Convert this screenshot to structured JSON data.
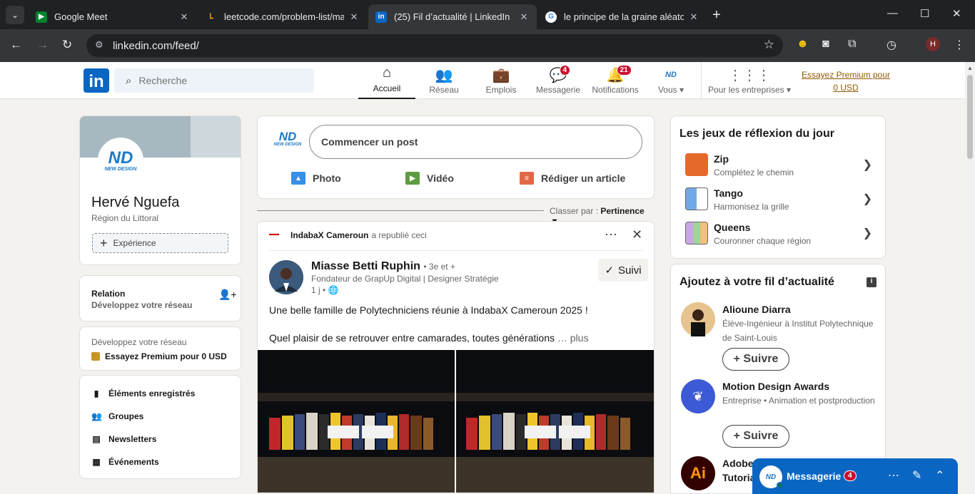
{
  "browser": {
    "tabs": [
      {
        "title": "Google Meet",
        "favicon": "meet-icon"
      },
      {
        "title": "leetcode.com/problem-list/mat",
        "favicon": "leetcode-icon"
      },
      {
        "title": "(25) Fil d’actualité | LinkedIn",
        "favicon": "linkedin-icon",
        "active": true
      },
      {
        "title": "le principe de la graine aléatoire",
        "favicon": "google-icon"
      }
    ],
    "url": "linkedin.com/feed/",
    "profile_initial": "H"
  },
  "header": {
    "logo": "in",
    "search_placeholder": "Recherche",
    "nav": [
      {
        "label": "Accueil",
        "icon": "home-icon",
        "badge": ""
      },
      {
        "label": "Réseau",
        "icon": "network-icon",
        "badge": ""
      },
      {
        "label": "Emplois",
        "icon": "briefcase-icon",
        "badge": ""
      },
      {
        "label": "Messagerie",
        "icon": "messaging-icon",
        "badge": "4"
      },
      {
        "label": "Notifications",
        "icon": "bell-icon",
        "badge": "21"
      },
      {
        "label": "Vous",
        "icon": "me-avatar",
        "badge": ""
      },
      {
        "label": "Pour les entreprises",
        "icon": "grid-icon",
        "badge": ""
      }
    ],
    "premium_link": "Essayez Premium pour 0 USD"
  },
  "profile": {
    "name": "Hervé Nguefa",
    "region": "Région du Littoral",
    "experience_btn": "Expérience",
    "avatar_text": "ND",
    "avatar_sub": "NEW DESIGN",
    "relation_title": "Relation",
    "relation_sub": "Développez votre réseau",
    "premium_title": "Développez votre réseau",
    "premium_cta": "Essayez Premium pour 0 USD",
    "links": [
      "Éléments enregistrés",
      "Groupes",
      "Newsletters",
      "Événements"
    ]
  },
  "composer": {
    "avatar_text": "ND",
    "avatar_sub": "NEW DESIGN",
    "placeholder": "Commencer un post",
    "actions": [
      "Photo",
      "Vidéo",
      "Rédiger un article"
    ]
  },
  "sort": {
    "label": "Classer par :",
    "value": "Pertinence"
  },
  "post": {
    "repost_org": "IndabaX Cameroun",
    "repost_suffix": "a republié ceci",
    "author": "Miasse Betti Ruphin",
    "degree": "• 3e et +",
    "author_title": "Fondateur de GrapUp Digital | Designer Stratégie",
    "time": "1 j •",
    "follow_label": "Suivi",
    "line1": "Une belle famille de Polytechniciens réunie à IndabaX Cameroun 2025 !",
    "line2": "Quel plaisir de se retrouver entre camarades, toutes générations",
    "more": "… plus"
  },
  "games": {
    "title": "Les jeux de réflexion du jour",
    "items": [
      {
        "name": "Zip",
        "desc": "Complétez le chemin"
      },
      {
        "name": "Tango",
        "desc": "Harmonisez la grille"
      },
      {
        "name": "Queens",
        "desc": "Couronner chaque région"
      }
    ]
  },
  "suggestions": {
    "title": "Ajoutez à votre fil d’actualité",
    "follow": "+ Suivre",
    "items": [
      {
        "name": "Alioune Diarra",
        "desc": "Élève-Ingénieur à Institut Polytechnique de Saint-Louis"
      },
      {
        "name": "Motion Design Awards",
        "desc": "Entreprise • Animation et postproduction"
      },
      {
        "name": "Adobe",
        "desc": "Tutoria",
        "logo": "Ai"
      }
    ]
  },
  "messaging": {
    "label": "Messagerie",
    "badge": "4",
    "avatar_text": "ND"
  }
}
